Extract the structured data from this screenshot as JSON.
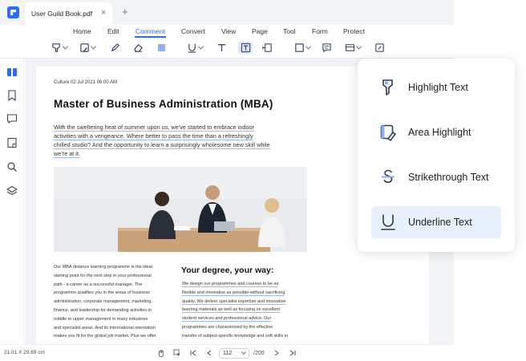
{
  "tabbar": {
    "doc_tab_label": "User Guild Book.pdf",
    "close_symbol": "×",
    "new_tab_symbol": "+"
  },
  "menubar": {
    "items": [
      "Home",
      "Edit",
      "Comment",
      "Convert",
      "View",
      "Page",
      "Tool",
      "Form",
      "Protect"
    ],
    "active": "Comment"
  },
  "toolbar": {
    "tools": [
      "highlight-dropdown",
      "area-highlight-dropdown",
      "pencil",
      "eraser",
      "color-swatch",
      "underline-dropdown",
      "text-tool",
      "text-box",
      "callout",
      "shape-dropdown",
      "comment",
      "stamp-dropdown",
      "attachment"
    ],
    "selected": "text-box"
  },
  "sidebar": {
    "items": [
      "thumbnails",
      "bookmark",
      "comments",
      "pages",
      "search",
      "layers"
    ],
    "active": "thumbnails"
  },
  "document": {
    "meta": "Culture 02 Jul 2021 06:00 AM",
    "title": "Master of Business Administration (MBA)",
    "intro_lines": [
      "With the sweltering heat of summer upon us, we've started to embrace indoor",
      "activities with a vengeance. Where better to pass the time than a refreshingly",
      "chilled studio? And the opportunity to learn a surprisingly wholesome new skill while",
      "we're at it."
    ],
    "left_col": [
      "Our MBA distance learning programme is the ideal",
      "starting point for the next step in your professional",
      "path - a career as a successful manager. The",
      "programme qualifies you in the areas of business",
      "administration, corporate management, marketing,",
      "finance, and leadership for demanding activities in",
      "middle to upper management in many industries",
      "and specialist areas. And its international orientation",
      "makes you fit for the global job market. Plus we offer"
    ],
    "right_title": "Your degree, your way:",
    "right_col": [
      "We design our programmes and courses to be as",
      "flexible and innovative as possible-without sacrificing",
      "quality. We deliver specialist expertise and innovative",
      "learning materials as well as focusing on excellent",
      "student services and professional advice. Our",
      "programmes are characterised by the effective",
      "transfer of subject-specific knowledge and soft skills in"
    ]
  },
  "popup": {
    "items": [
      {
        "label": "Highlight Text",
        "icon": "highlighter-icon"
      },
      {
        "label": "Area Highlight",
        "icon": "area-highlight-icon"
      },
      {
        "label": "Strikethrough Text",
        "icon": "strikethrough-icon"
      },
      {
        "label": "Underline Text",
        "icon": "underline-icon"
      }
    ],
    "selected": "Underline Text"
  },
  "statusbar": {
    "dimensions": "21.01 X 29.69 cm",
    "current_page": "112",
    "total_pages": "/200"
  },
  "colors": {
    "accent": "#2d6cf6",
    "selected_bg": "#e8f0fd",
    "underline": "#9db8ee",
    "icon": "#2b3a55"
  }
}
